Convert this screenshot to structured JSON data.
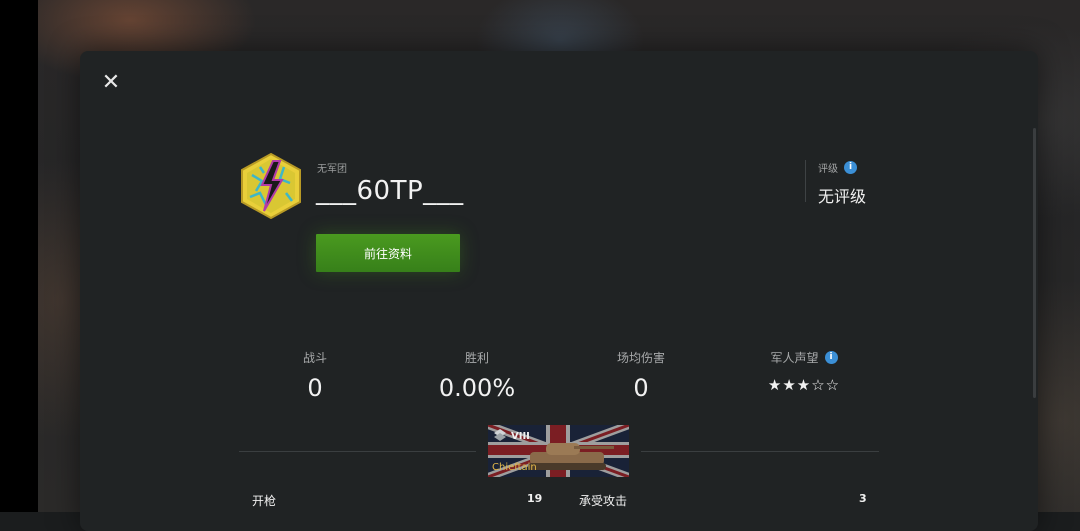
{
  "player": {
    "clan": "无军团",
    "nickname": "___60TP___",
    "profile_button": "前往资料"
  },
  "rating": {
    "label": "评级",
    "value": "无评级"
  },
  "stats": [
    {
      "label": "战斗",
      "value": "0"
    },
    {
      "label": "胜利",
      "value": "0.00%"
    },
    {
      "label": "场均伤害",
      "value": "0"
    },
    {
      "label": "军人声望",
      "stars": "★★★☆☆"
    }
  ],
  "tank": {
    "tier": "VIII",
    "name": "Chieftain"
  },
  "details": [
    {
      "label": "开枪",
      "value": "19"
    },
    {
      "label": "承受攻击",
      "value": "3"
    }
  ],
  "icons": {
    "close": "close-icon",
    "info": "info-icon",
    "emblem": "lightning-emblem-icon"
  },
  "colors": {
    "accent_green": "#3f8f1d",
    "info_blue": "#3b8fd6",
    "tank_name": "#e3b84a"
  }
}
